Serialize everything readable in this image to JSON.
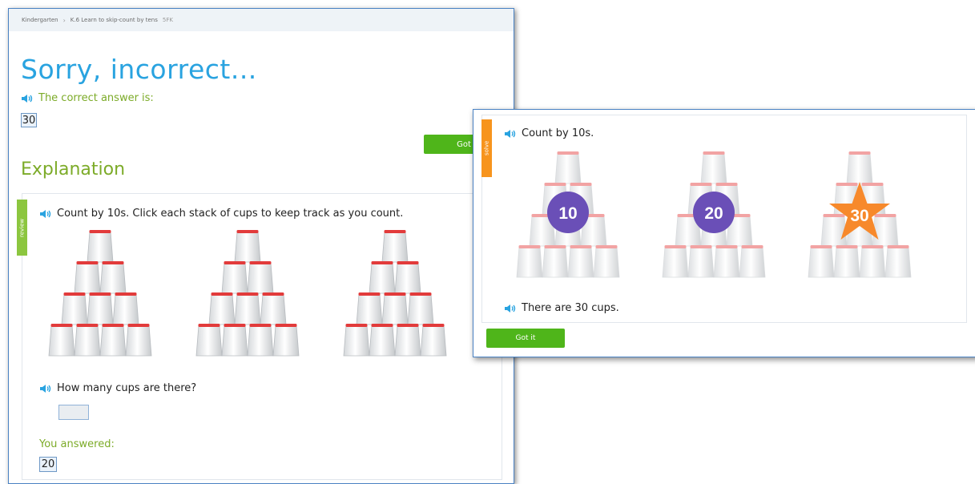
{
  "breadcrumb": {
    "grade": "Kindergarten",
    "skill": "K.6 Learn to skip-count by tens",
    "code": "5FK"
  },
  "result": {
    "heading": "Sorry, incorrect...",
    "correct_prompt": "The correct answer is:",
    "correct_value": "30"
  },
  "got_it_top_label": "Got it",
  "explanation_heading": "Explanation",
  "review": {
    "tag": "review",
    "instruction": "Count by 10s. Click each stack of cups to keep track as you count.",
    "question": "How many cups are there?",
    "you_answered_label": "You answered:",
    "you_answered_value": "20",
    "stack_count": 3
  },
  "solve": {
    "tag": "solve",
    "instruction": "Count by 10s.",
    "counts": [
      {
        "label": "10",
        "shape": "circle",
        "color": "#6a4fb7"
      },
      {
        "label": "20",
        "shape": "circle",
        "color": "#6a4fb7"
      },
      {
        "label": "30",
        "shape": "star",
        "color": "#f7892b"
      }
    ],
    "conclusion": "There are 30 cups.",
    "got_it_label": "Got it"
  },
  "colors": {
    "accent_blue": "#29a3e0",
    "green_text": "#7cab28",
    "button_green": "#4fb51a",
    "cup_rim_red": "#e23b3b"
  },
  "icons": {
    "speaker": "speaker-icon",
    "cups": "cup-stack-icon"
  }
}
